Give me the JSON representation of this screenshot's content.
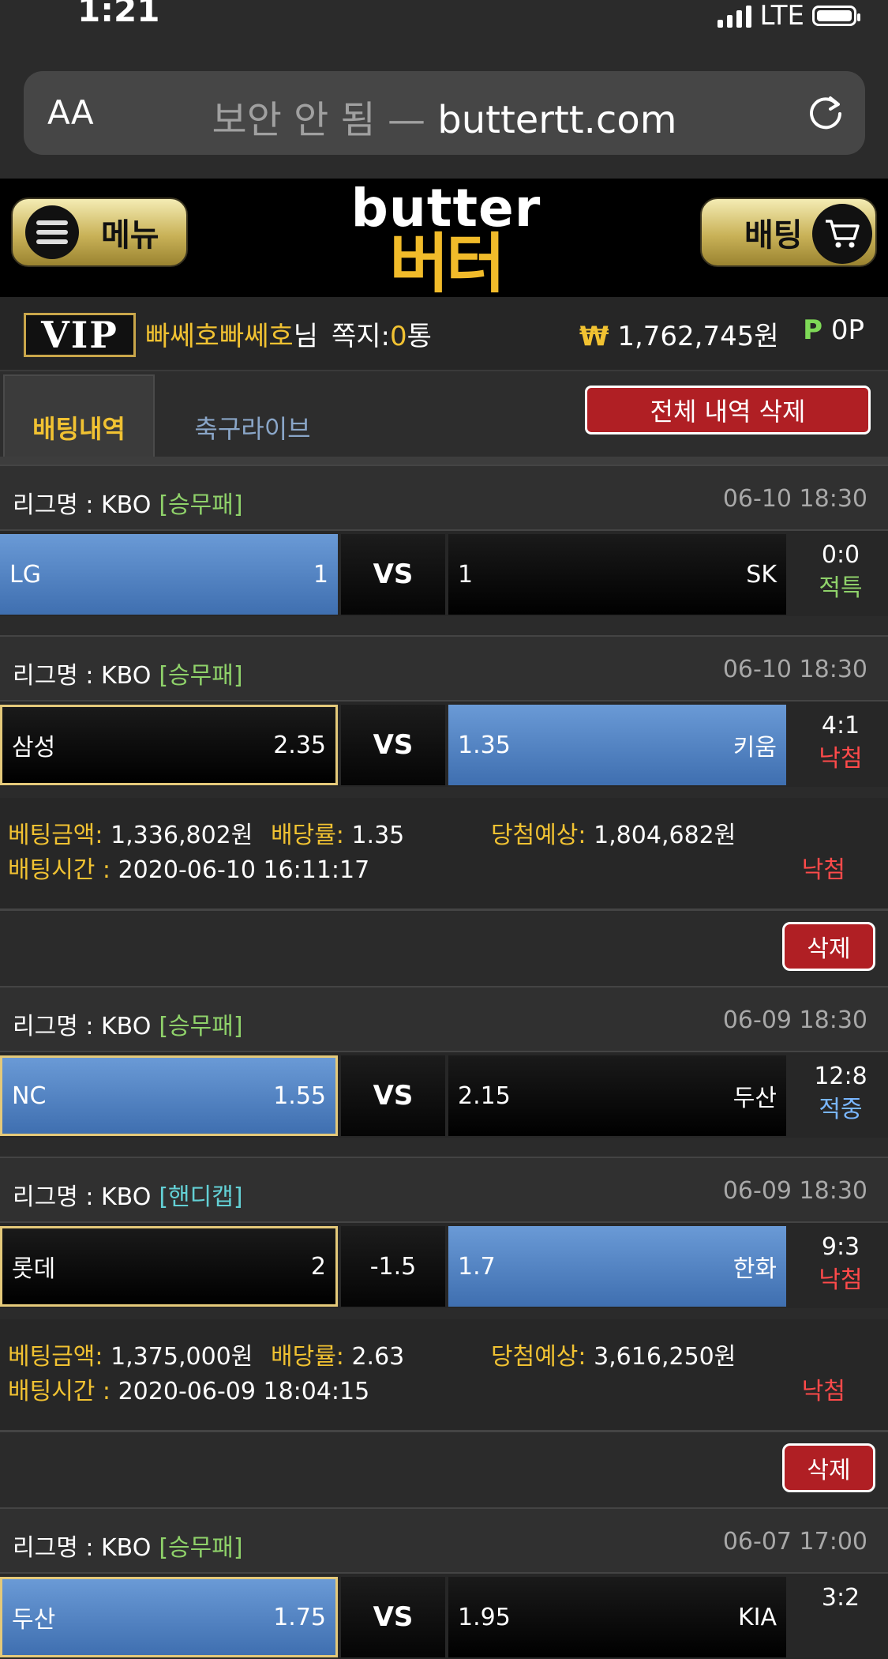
{
  "status_bar": {
    "time": "1:21",
    "network": "LTE"
  },
  "browser": {
    "aa_label": "AA",
    "insecure_label": "보안 안 됨 —",
    "domain": "buttertt.com"
  },
  "header": {
    "menu_label": "메뉴",
    "logo_en": "butter",
    "logo_ko": "버터",
    "bet_label": "배팅"
  },
  "user": {
    "vip_label": "VIP",
    "username": "빠쎄호빠쎄호",
    "honorific": "님",
    "msg_label": "쪽지:",
    "msg_count": "0",
    "msg_unit": "통",
    "won_symbol": "₩",
    "balance": "1,762,745원",
    "points_symbol": "P",
    "points": "0P"
  },
  "tabs": {
    "active": "배팅내역",
    "other": "축구라이브",
    "delete_all": "전체 내역 삭제"
  },
  "bets": [
    {
      "league": "리그명 : KBO",
      "type": "[승무패]",
      "type_color": "g",
      "datetime": "06-10 18:30",
      "home": "LG",
      "home_odds": "1",
      "mid": "VS",
      "away_odds": "1",
      "away": "SK",
      "score": "0:0",
      "result": "적특",
      "result_color": "green"
    },
    {
      "league": "리그명 : KBO",
      "type": "[승무패]",
      "type_color": "g",
      "datetime": "06-10 18:30",
      "home": "삼성",
      "home_odds": "2.35",
      "mid": "VS",
      "away_odds": "1.35",
      "away": "키움",
      "score": "4:1",
      "result": "낙첨",
      "result_color": "red"
    },
    {
      "league": "리그명 : KBO",
      "type": "[승무패]",
      "type_color": "g",
      "datetime": "06-09 18:30",
      "home": "NC",
      "home_odds": "1.55",
      "mid": "VS",
      "away_odds": "2.15",
      "away": "두산",
      "score": "12:8",
      "result": "적중",
      "result_color": "blue"
    },
    {
      "league": "리그명 : KBO",
      "type": "[핸디캡]",
      "type_color": "c",
      "datetime": "06-09 18:30",
      "home": "롯데",
      "home_odds": "2",
      "mid": "-1.5",
      "away_odds": "1.7",
      "away": "한화",
      "score": "9:3",
      "result": "낙첨",
      "result_color": "red"
    },
    {
      "league": "리그명 : KBO",
      "type": "[승무패]",
      "type_color": "g",
      "datetime": "06-07 17:00",
      "home": "두산",
      "home_odds": "1.75",
      "mid": "VS",
      "away_odds": "1.95",
      "away": "KIA",
      "score": "3:2",
      "result": "",
      "result_color": "red"
    }
  ],
  "slips": [
    {
      "amount_label": "베팅금액:",
      "amount": "1,336,802원",
      "odds_label": "배당률:",
      "odds": "1.35",
      "expected_label": "당첨예상:",
      "expected": "1,804,682원",
      "time_label": "배팅시간 :",
      "time": "2020-06-10 16:11:17",
      "status": "낙첨",
      "delete": "삭제"
    },
    {
      "amount_label": "베팅금액:",
      "amount": "1,375,000원",
      "odds_label": "배당률:",
      "odds": "2.63",
      "expected_label": "당첨예상:",
      "expected": "3,616,250원",
      "time_label": "배팅시간 :",
      "time": "2020-06-09 18:04:15",
      "status": "낙첨",
      "delete": "삭제"
    }
  ]
}
